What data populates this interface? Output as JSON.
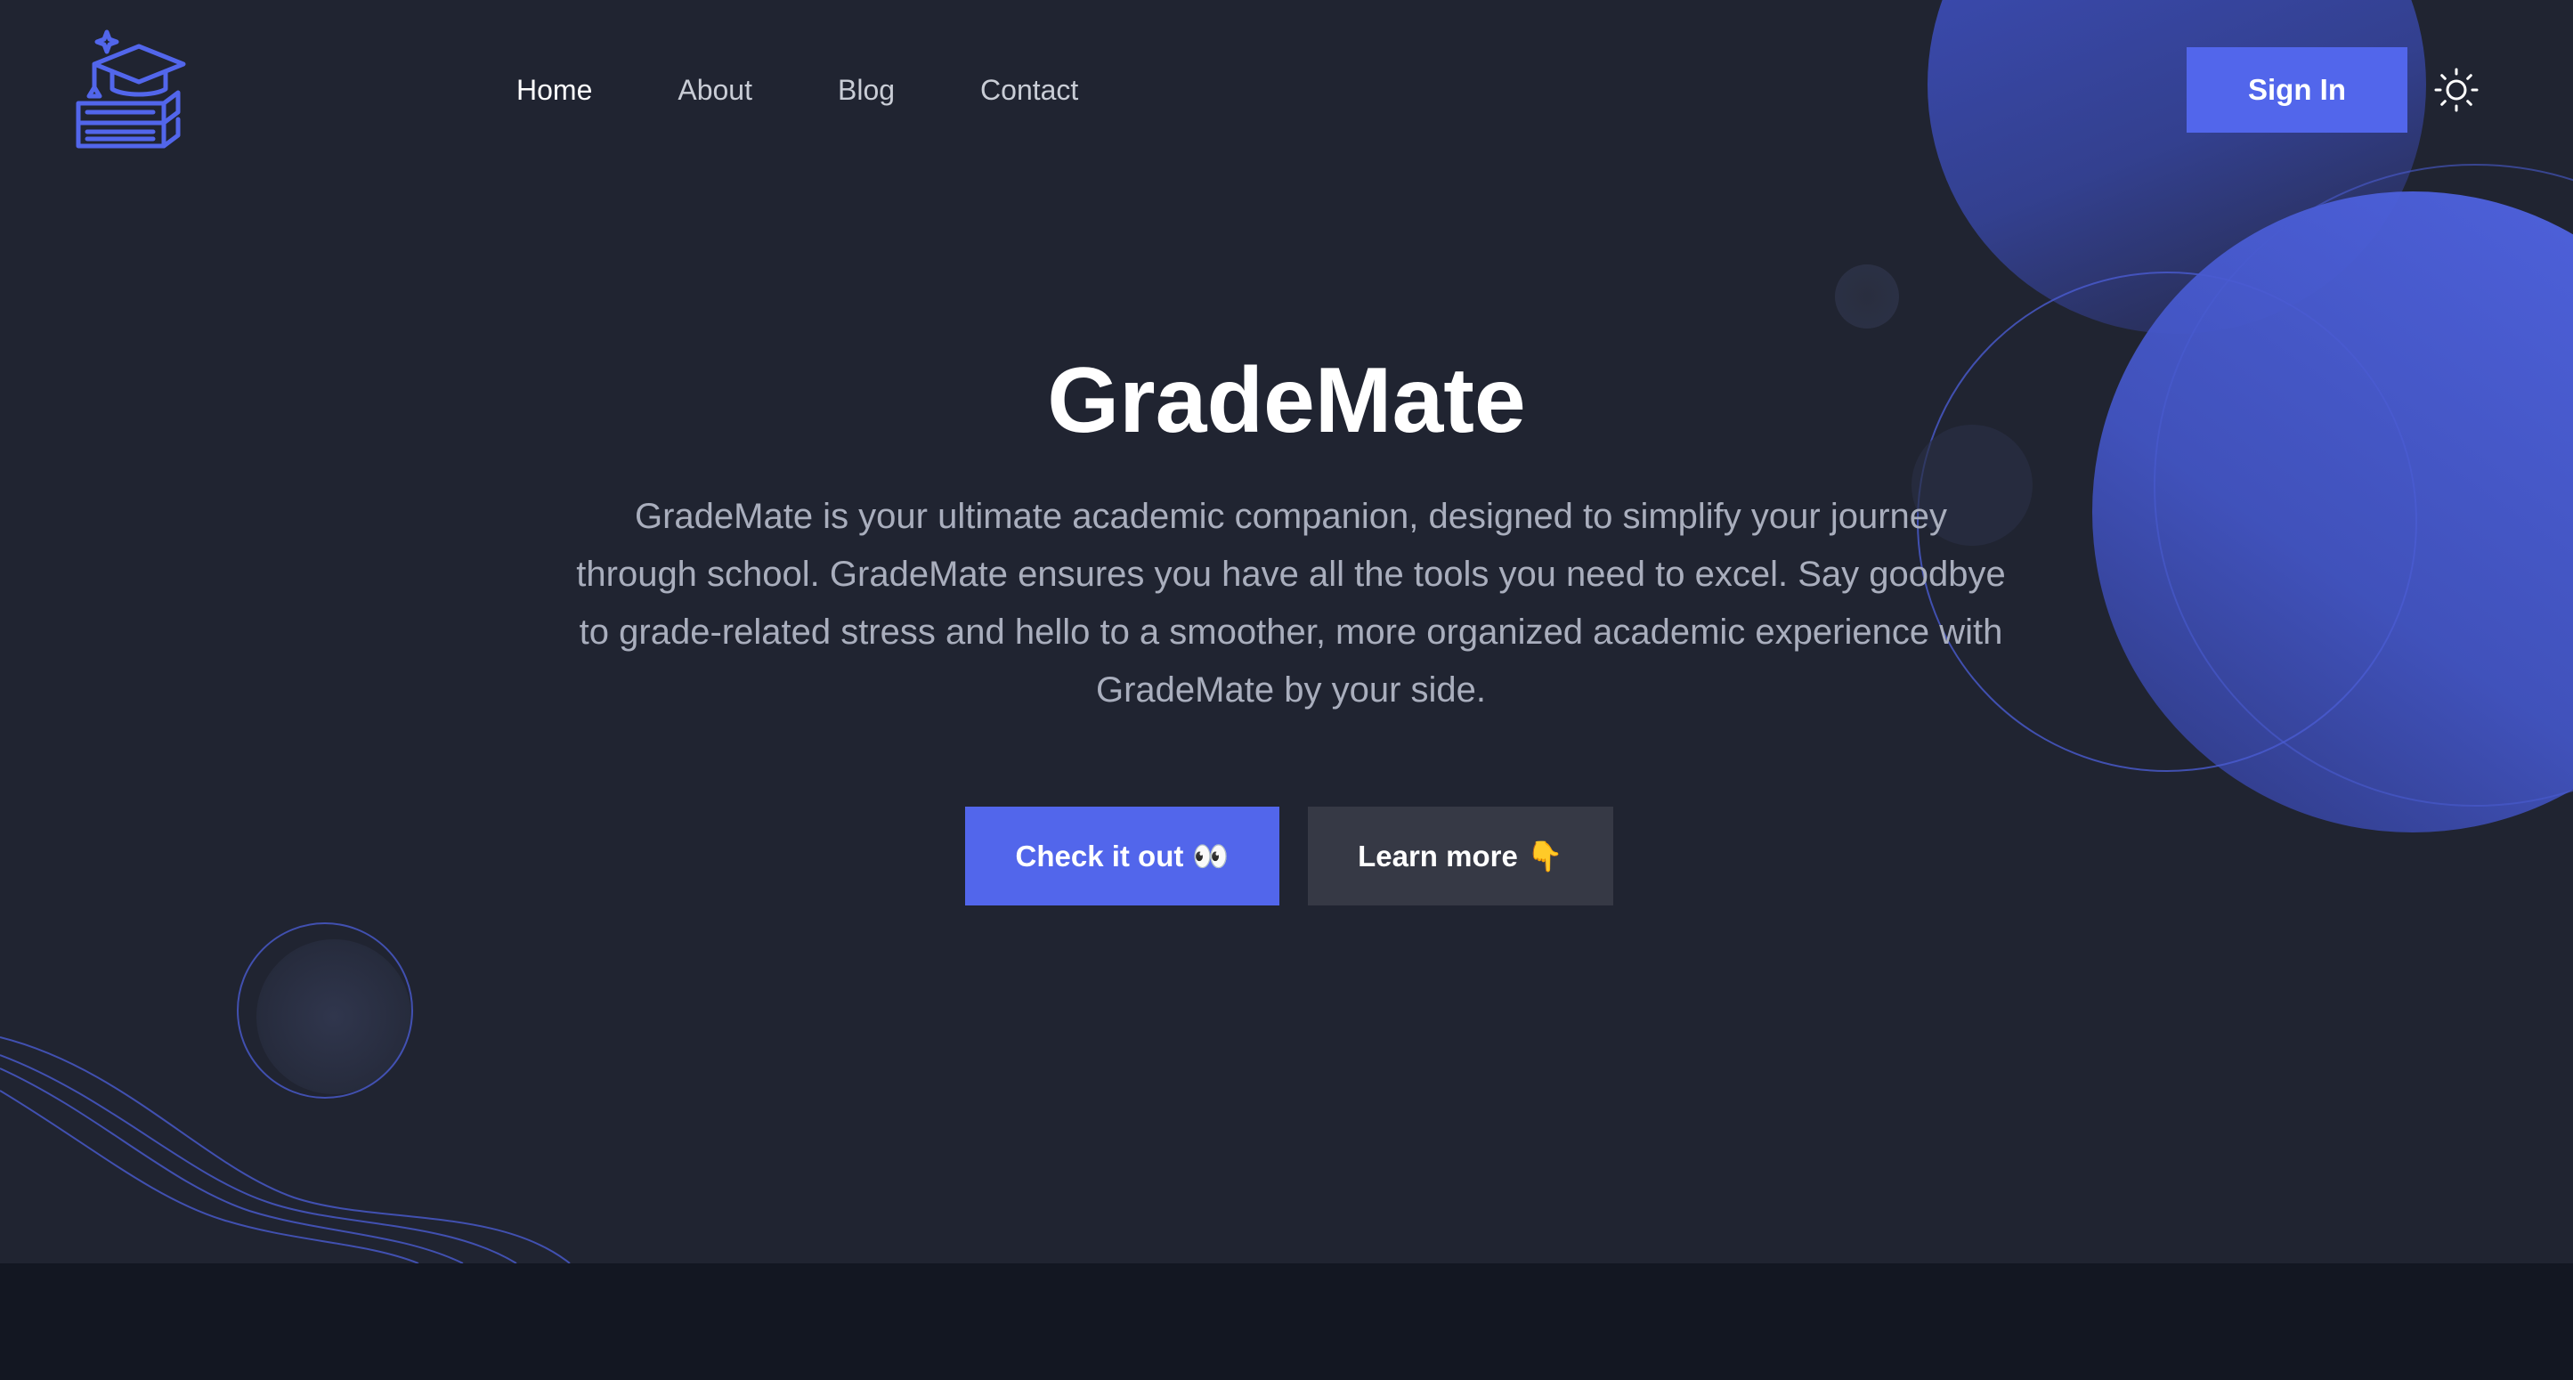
{
  "header": {
    "nav": [
      {
        "label": "Home",
        "active": true
      },
      {
        "label": "About",
        "active": false
      },
      {
        "label": "Blog",
        "active": false
      },
      {
        "label": "Contact",
        "active": false
      }
    ],
    "signin_label": "Sign In",
    "logo_icon": "graduation-books-icon",
    "theme_icon": "sun-icon"
  },
  "hero": {
    "title": "GradeMate",
    "description": "GradeMate is your ultimate academic companion, designed to simplify your journey through school. GradeMate ensures you have all the tools you need to excel. Say goodbye to grade-related stress and hello to a smoother, more organized academic experience with GradeMate by your side.",
    "primary_button": {
      "label": "Check it out",
      "emoji": "👀"
    },
    "secondary_button": {
      "label": "Learn more",
      "emoji": "👇"
    }
  },
  "colors": {
    "accent": "#5266eb",
    "background": "#202431",
    "footer": "#131722",
    "text_muted": "#a9aebd"
  }
}
